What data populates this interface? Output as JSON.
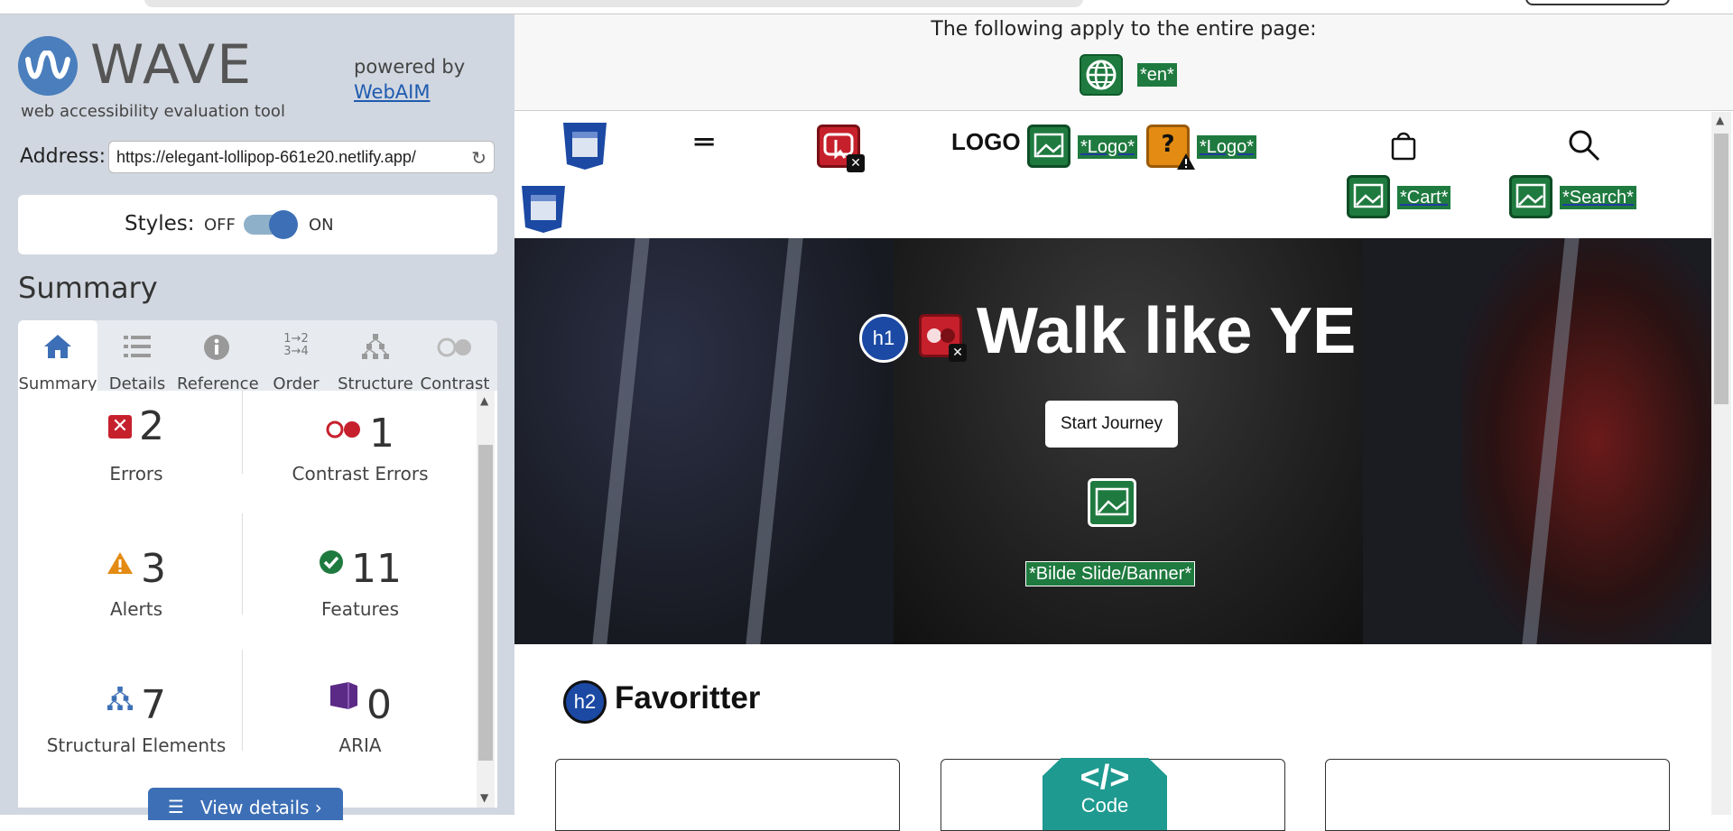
{
  "wave": {
    "brand": "WAVE",
    "subtitle": "web accessibility evaluation tool",
    "powered_by": "powered by",
    "powered_link": "WebAIM",
    "address_label": "Address:",
    "address_value": "https://elegant-lollipop-661e20.netlify.app/",
    "styles_label": "Styles:",
    "styles_off": "OFF",
    "styles_on": "ON",
    "styles_state": "on",
    "summary_heading": "Summary",
    "tabs": [
      {
        "label": "Summary",
        "icon": "home-icon",
        "active": true
      },
      {
        "label": "Details",
        "icon": "list-icon",
        "active": false
      },
      {
        "label": "Reference",
        "icon": "info-icon",
        "active": false
      },
      {
        "label": "Order",
        "icon": "order-icon",
        "active": false
      },
      {
        "label": "Structure",
        "icon": "hierarchy-icon",
        "active": false
      },
      {
        "label": "Contrast",
        "icon": "contrast-icon",
        "active": false
      }
    ],
    "stats": {
      "errors": {
        "count": "2",
        "label": "Errors",
        "icon": "error-icon",
        "color": "#c6202c"
      },
      "contrast": {
        "count": "1",
        "label": "Contrast Errors",
        "icon": "contrast-error-icon",
        "color": "#c6202c"
      },
      "alerts": {
        "count": "3",
        "label": "Alerts",
        "icon": "alert-icon",
        "color": "#e38b12"
      },
      "features": {
        "count": "11",
        "label": "Features",
        "icon": "feature-icon",
        "color": "#1f7a3f"
      },
      "structural": {
        "count": "7",
        "label": "Structural Elements",
        "icon": "structure-icon",
        "color": "#3d6fb6"
      },
      "aria": {
        "count": "0",
        "label": "ARIA",
        "icon": "aria-icon",
        "color": "#5b2a86"
      }
    },
    "view_details": "View details ›"
  },
  "page": {
    "entire_page_label": "The following apply to the entire page:",
    "lang_tag": "*en*",
    "nav": {
      "logo_text": "LOGO",
      "logo_tag_1": "*Logo*",
      "logo_tag_2": "*Logo*",
      "cart_tag": "*Cart*",
      "search_tag": "*Search*"
    },
    "hero": {
      "title": "Walk like YE",
      "h1_badge": "h1",
      "button": "Start Journey",
      "image_tag": "*Bilde Slide/Banner*"
    },
    "favorites": {
      "heading": "Favoritter",
      "h2_badge": "h2"
    },
    "code_badge": {
      "symbol": "</>",
      "label": "Code"
    }
  },
  "colors": {
    "wave_blue": "#3d6fb6",
    "feature_green": "#1f7a3f",
    "error_red": "#c6202c",
    "alert_orange": "#e38b12",
    "sidebar_bg": "#d1d7e0"
  }
}
